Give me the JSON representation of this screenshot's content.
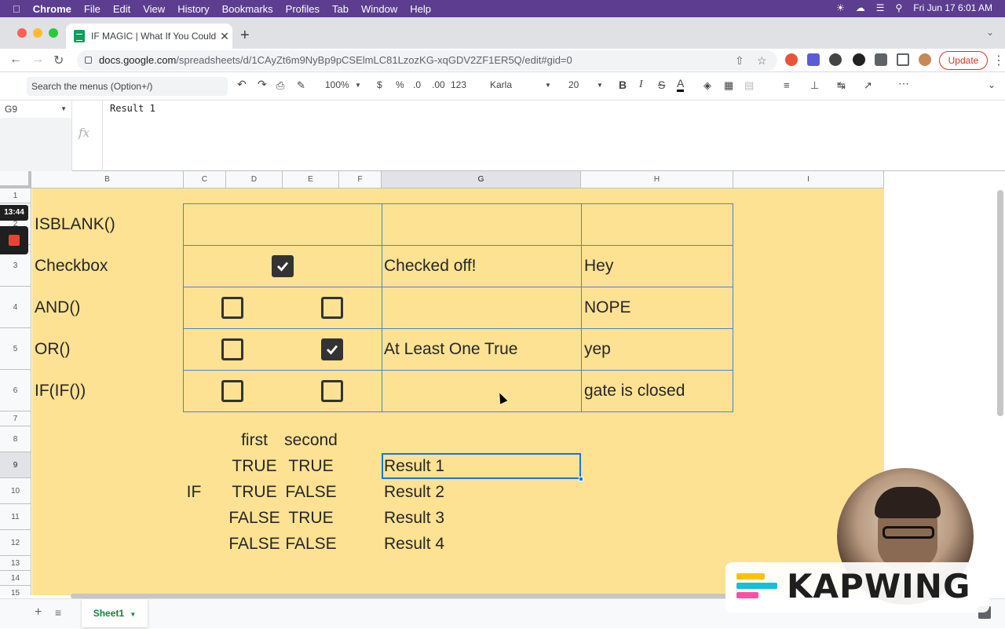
{
  "menubar": {
    "apple_icon": "apple-icon",
    "app": "Chrome",
    "items": [
      "File",
      "Edit",
      "View",
      "History",
      "Bookmarks",
      "Profiles",
      "Tab",
      "Window",
      "Help"
    ],
    "clock": "Fri Jun 17  6:01 AM"
  },
  "browser": {
    "tab_title": "IF MAGIC | What If You Could F",
    "url_domain": "docs.google.com",
    "url_path": "/spreadsheets/d/1CAyZt6m9NyBp9pCSElmLC81LzozKG-xqGDV2ZF1ER5Q/edit#gid=0",
    "update_label": "Update"
  },
  "toolbar": {
    "search_placeholder": "Search the menus (Option+/)",
    "zoom": "100%",
    "currency": "$",
    "percent": "%",
    "dec_less": ".0",
    "dec_more": ".00",
    "num_format": "123",
    "font": "Karla",
    "font_size": "20"
  },
  "formula": {
    "name_box": "G9",
    "fx": "fx",
    "content": "Result 1"
  },
  "columns": [
    "B",
    "C",
    "D",
    "E",
    "F",
    "G",
    "H",
    "I"
  ],
  "rows": [
    "1",
    "2",
    "3",
    "4",
    "5",
    "6",
    "7",
    "8",
    "9",
    "10",
    "11",
    "12",
    "13",
    "14",
    "15"
  ],
  "cells": {
    "b2": "ISBLANK()",
    "b3": "Checkbox",
    "b4": "AND()",
    "b5": "OR()",
    "b6": "IF(IF())",
    "g3": "Checked off!",
    "g5": "At Least One True",
    "h3": "Hey",
    "h4": "NOPE",
    "h5": "yep",
    "h6": "gate is closed",
    "d8": "first",
    "e8": "second",
    "d9": "TRUE",
    "e9": "TRUE",
    "c10": "IF",
    "d10": "TRUE",
    "e10": "FALSE",
    "d11": "FALSE",
    "e11": "TRUE",
    "d12": "FALSE",
    "e12": "FALSE",
    "g9": "Result 1",
    "g10": "Result 2",
    "g11": "Result 3",
    "g12": "Result 4"
  },
  "checkboxes": {
    "d3": true,
    "d4": false,
    "e4": false,
    "d5": false,
    "e5": true,
    "d6": false,
    "e6": false
  },
  "recording": {
    "timer": "13:44"
  },
  "sheet_tab": "Sheet1",
  "watermark": "KAPWING",
  "colors": {
    "sheet_fill": "#fde293",
    "border_blue": "#4a86c8",
    "selection": "#1a73e8",
    "menubar": "#5c3d8f"
  }
}
